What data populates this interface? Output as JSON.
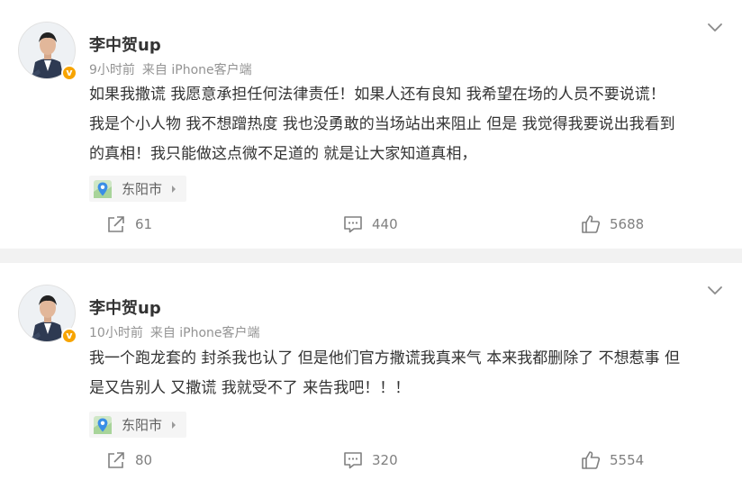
{
  "posts": [
    {
      "username": "李中贺up",
      "time": "9小时前",
      "source": "来自 iPhone客户端",
      "text_lines": [
        "如果我撒谎 我愿意承担任何法律责任！如果人还有良知 我希望在场的人员不要说谎！",
        "我是个小人物 我不想蹭热度 我也没勇敢的当场站出来阻止 但是 我觉得我要说出我看到",
        "的真相！我只能做这点微不足道的 就是让大家知道真相，"
      ],
      "location": "东阳市",
      "reposts": "61",
      "comments": "440",
      "likes": "5688"
    },
    {
      "username": "李中贺up",
      "time": "10小时前",
      "source": "来自 iPhone客户端",
      "text_lines": [
        "我一个跑龙套的 封杀我也认了 但是他们官方撒谎我真来气 本来我都删除了 不想惹事 但",
        "是又告别人 又撒谎 我就受不了 来告我吧！！！"
      ],
      "location": "东阳市",
      "reposts": "80",
      "comments": "320",
      "likes": "5554"
    }
  ],
  "icons": {
    "expand": "chevron-down-icon",
    "repost": "share-icon",
    "comment": "comment-icon",
    "like": "thumbs-up-icon",
    "location": "map-pin-icon",
    "verified": "verified-badge-icon"
  },
  "colors": {
    "name": "#333333",
    "meta": "#939393",
    "counts": "#808080",
    "verified": "#f7a400",
    "location_pin": "#3a8ee6",
    "separator": "#f2f2f2"
  }
}
